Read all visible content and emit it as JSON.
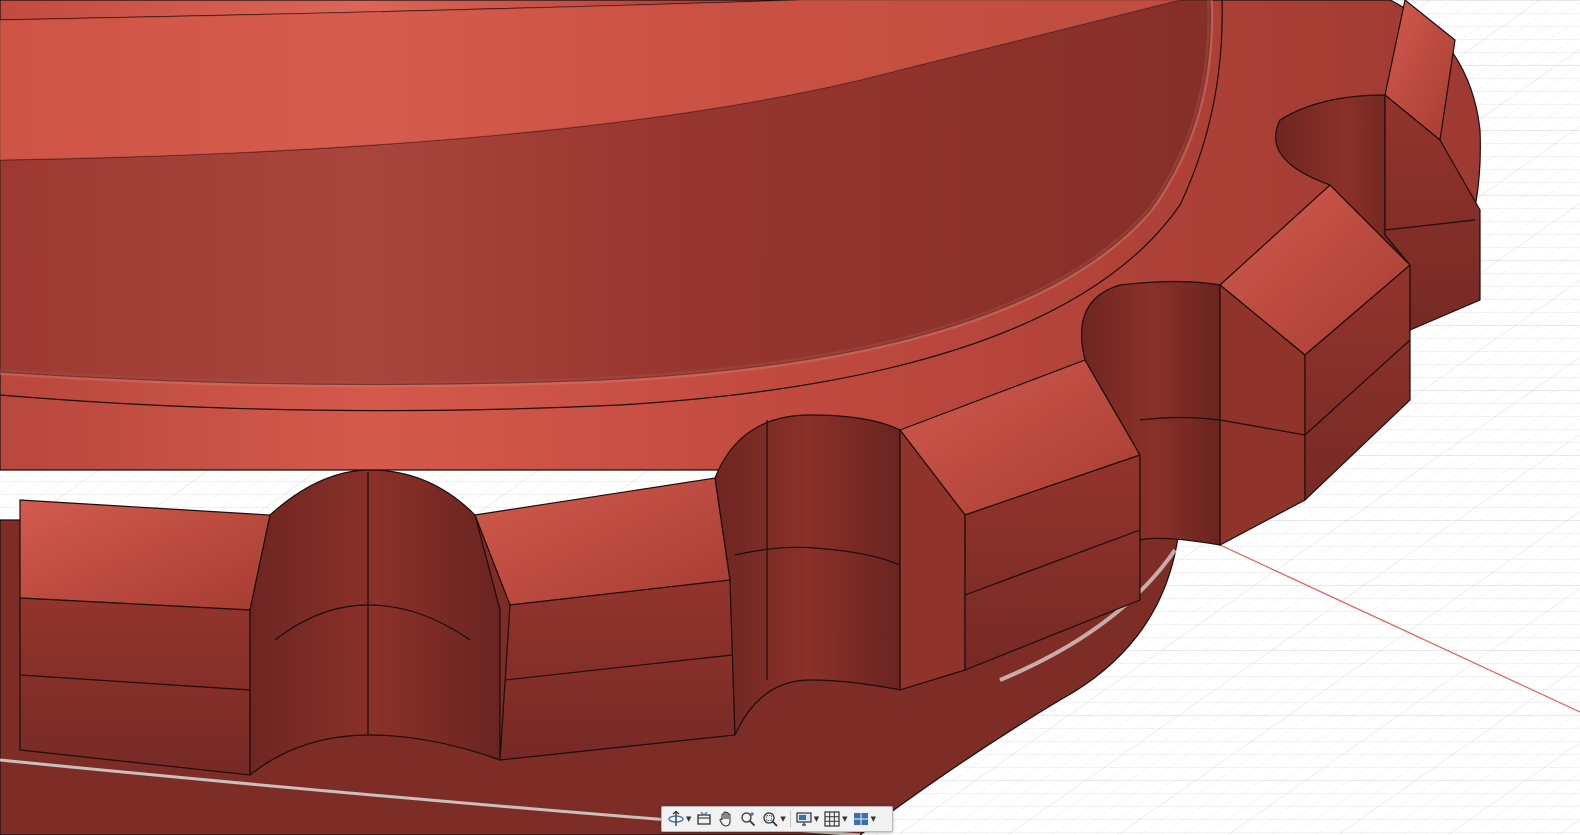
{
  "canvas": {
    "background": "#ffffff",
    "grid_line_color": "#d4d8dd",
    "axis_x_color": "#e85a5a",
    "model_color_light": "#c7493e",
    "model_color_mid": "#a8392f",
    "model_color_dark": "#7e2b26",
    "edge_color": "#1a0d0b"
  },
  "navigation_toolbar": {
    "buttons": [
      {
        "name": "orbit",
        "icon": "orbit-icon",
        "has_dropdown": true
      },
      {
        "name": "look-at",
        "icon": "look-at-icon",
        "has_dropdown": false
      },
      {
        "name": "pan",
        "icon": "pan-hand-icon",
        "has_dropdown": false
      },
      {
        "name": "zoom",
        "icon": "zoom-icon",
        "has_dropdown": false
      },
      {
        "name": "fit",
        "icon": "zoom-window-icon",
        "has_dropdown": true
      },
      {
        "name": "display-settings",
        "icon": "display-icon",
        "has_dropdown": true
      },
      {
        "name": "grid-snaps",
        "icon": "grid-icon",
        "has_dropdown": true
      },
      {
        "name": "viewports",
        "icon": "viewports-icon",
        "has_dropdown": true
      }
    ]
  }
}
